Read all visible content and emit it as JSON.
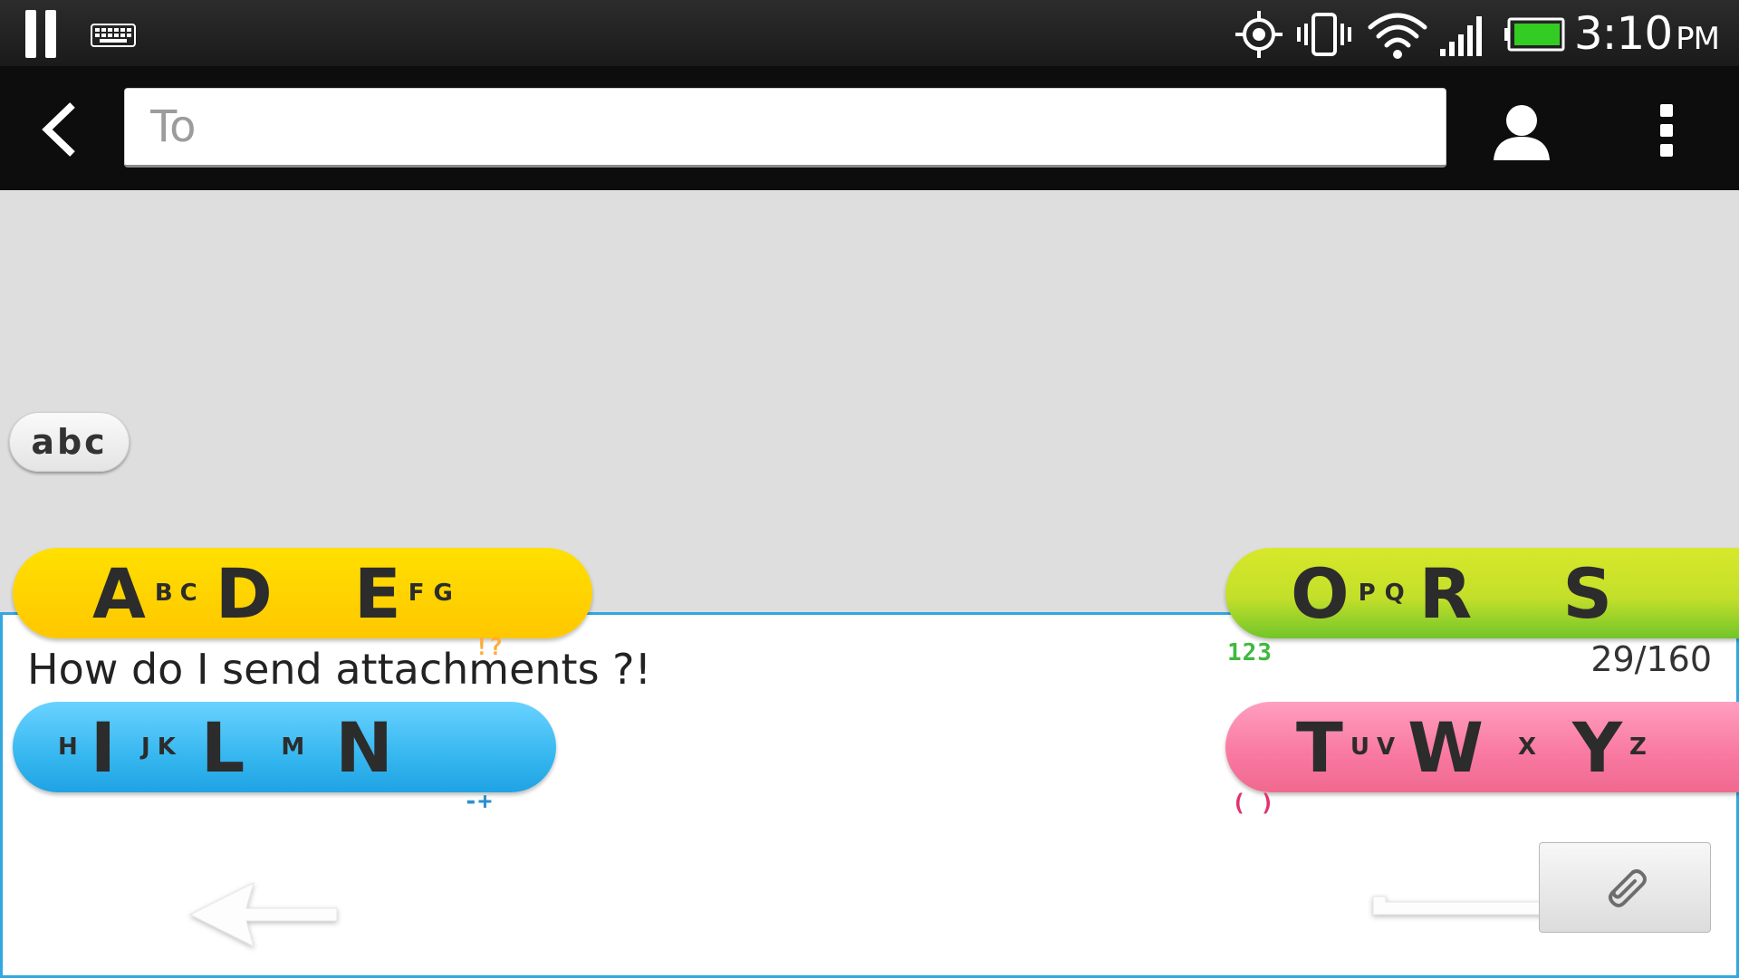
{
  "status_bar": {
    "time": "3:10",
    "ampm": "PM",
    "icons": [
      "pause-icon",
      "keyboard-icon",
      "gps-icon",
      "vibrate-icon",
      "wifi-icon",
      "signal-icon",
      "battery-icon"
    ]
  },
  "action_bar": {
    "back_icon": "chevron-left-icon",
    "to_placeholder": "To",
    "to_value": "",
    "contact_icon": "person-icon",
    "menu_icon": "overflow-menu-icon"
  },
  "conversation": {
    "mode_button_label": "abc"
  },
  "compose": {
    "message": "How do I send attachments ?!",
    "counter": "29/160"
  },
  "keyboard": {
    "keys": [
      {
        "id": "abcdefg",
        "parts": [
          [
            "A",
            "big"
          ],
          [
            "B",
            "small"
          ],
          [
            "C",
            "small"
          ],
          [
            "D",
            "big"
          ],
          [
            "E",
            "big"
          ],
          [
            "F",
            "small"
          ],
          [
            "G",
            "small"
          ]
        ],
        "color": "#ffd200"
      },
      {
        "id": "opqrs",
        "parts": [
          [
            "O",
            "big"
          ],
          [
            "P",
            "small"
          ],
          [
            "Q",
            "small"
          ],
          [
            "R",
            "big"
          ],
          [
            "S",
            "big"
          ]
        ],
        "color": "#b6dd2a"
      },
      {
        "id": "hijklmn",
        "parts": [
          [
            "H",
            "small"
          ],
          [
            "I",
            "big"
          ],
          [
            "J",
            "small"
          ],
          [
            "K",
            "small"
          ],
          [
            "L",
            "big"
          ],
          [
            "M",
            "small"
          ],
          [
            "N",
            "big"
          ]
        ],
        "color": "#36b7ef"
      },
      {
        "id": "tuvwxyz",
        "parts": [
          [
            "T",
            "big"
          ],
          [
            "U",
            "small"
          ],
          [
            "V",
            "small"
          ],
          [
            "W",
            "big"
          ],
          [
            "X",
            "small"
          ],
          [
            "Y",
            "big"
          ],
          [
            "Z",
            "small"
          ]
        ],
        "color": "#f97aa3"
      }
    ],
    "hints": {
      "punct": "!?",
      "num": "123",
      "math": "-+",
      "paren": "( )"
    }
  },
  "bottom": {
    "backspace_icon": "backspace-arrow-icon",
    "attach_icon": "paperclip-icon"
  },
  "colors": {
    "accent": "#33a7df",
    "status_bg": "#1a1a1a",
    "action_bg": "#0d0d0d",
    "conversation_bg": "#dedede"
  }
}
